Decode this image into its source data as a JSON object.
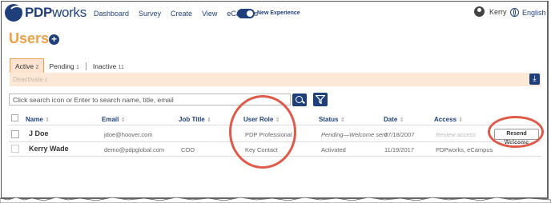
{
  "header": {
    "logo_text_bold": "PDP",
    "logo_text_rest": "works",
    "nav": [
      "Dashboard",
      "Survey",
      "Create",
      "View",
      "eCampus"
    ],
    "new_experience_label": "New Experience",
    "user_name": "Kerry",
    "language": "English"
  },
  "page": {
    "title": "Users",
    "tabs": [
      {
        "label": "Active",
        "count": "2"
      },
      {
        "label": "Pending",
        "count": "1"
      },
      {
        "label": "Inactive",
        "count": "11"
      }
    ],
    "deactivate_label": "Deactivate",
    "deactivate_count": "0",
    "search_placeholder": "Click search icon or Enter to search name, title, email"
  },
  "table": {
    "columns": [
      "Name",
      "Email",
      "Job Title",
      "User Role",
      "Status",
      "Date",
      "Access"
    ],
    "rows": [
      {
        "name": "J Doe",
        "email": "jdoe@hoover.com",
        "job_title": "",
        "role": "PDP Professional",
        "status": "Pending—Welcome sent",
        "date": "07/18/2007",
        "access": "Review access",
        "action": "Resend Welcome"
      },
      {
        "name": "Kerry Wade",
        "email": "demo@pdpglobal.com",
        "job_title": "COO",
        "role": "Key Contact",
        "status": "Activated",
        "date": "11/19/2017",
        "access": "PDPworks, eCampus",
        "action": ""
      }
    ]
  },
  "colors": {
    "brand_navy": "#1f3f7a",
    "accent_orange": "#f2a045",
    "highlight_red": "#e05a4a"
  }
}
